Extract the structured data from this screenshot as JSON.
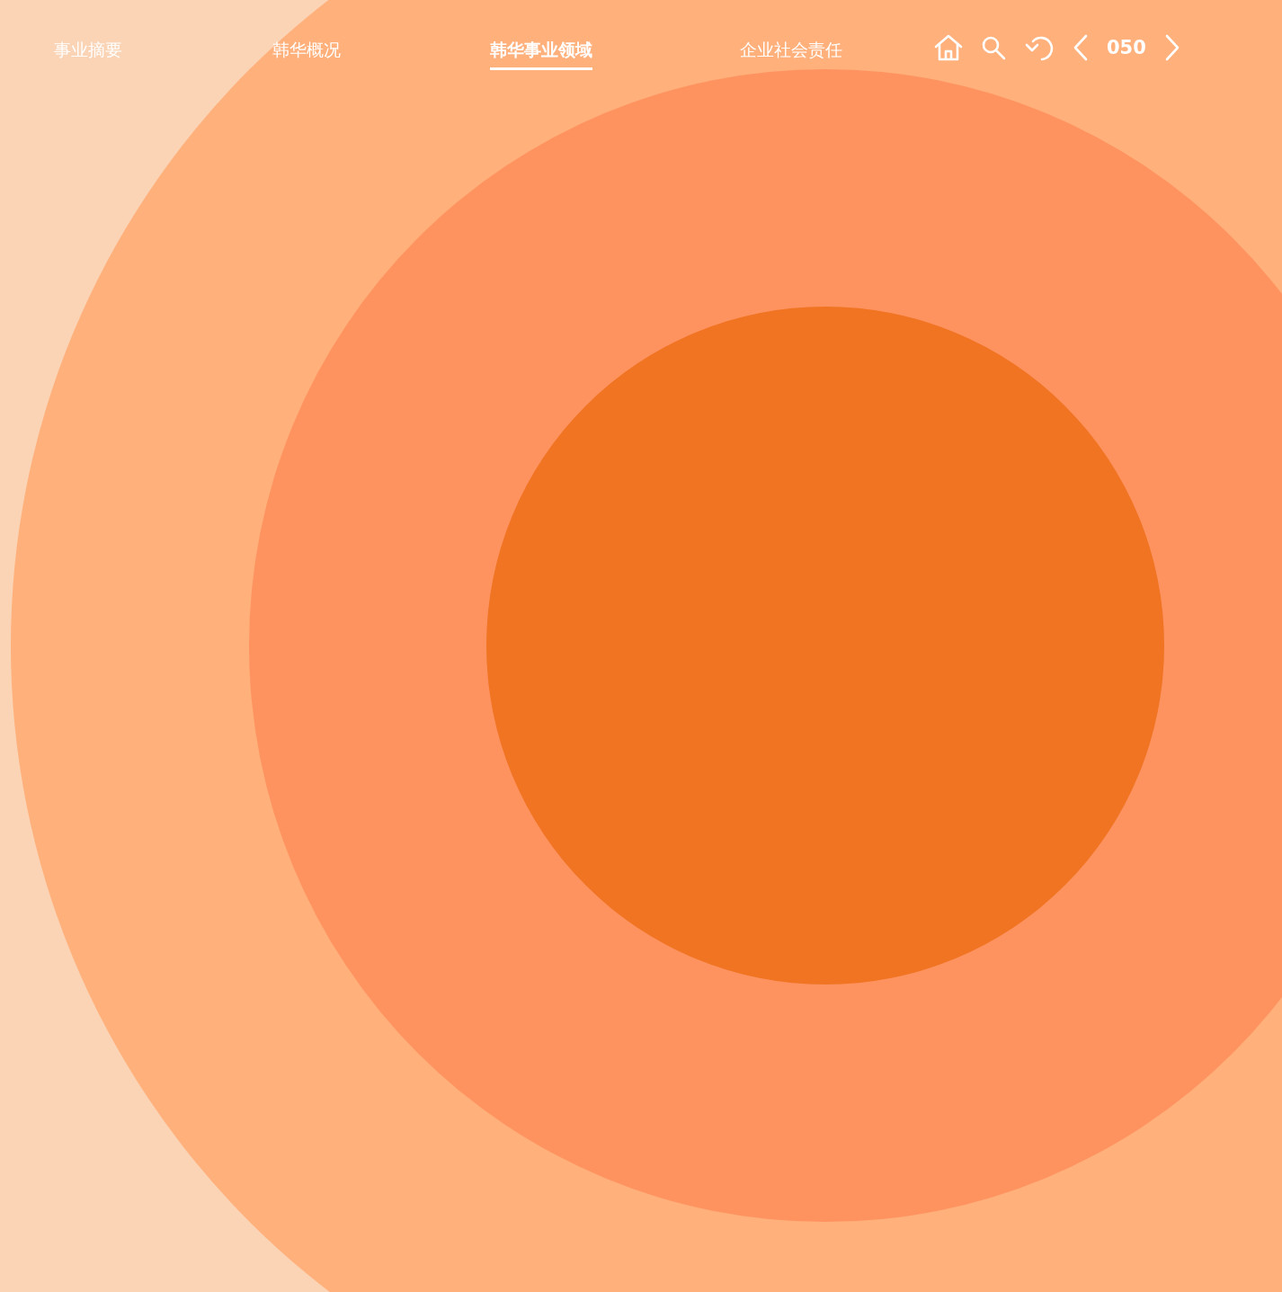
{
  "nav": {
    "tabs": [
      {
        "label": "事业摘要",
        "selected": false
      },
      {
        "label": "韩华概况",
        "selected": false
      },
      {
        "label": "韩华事业领域",
        "selected": true
      },
      {
        "label": "企业社会责任",
        "selected": false
      }
    ]
  },
  "toolbar": {
    "page_number": "050"
  }
}
